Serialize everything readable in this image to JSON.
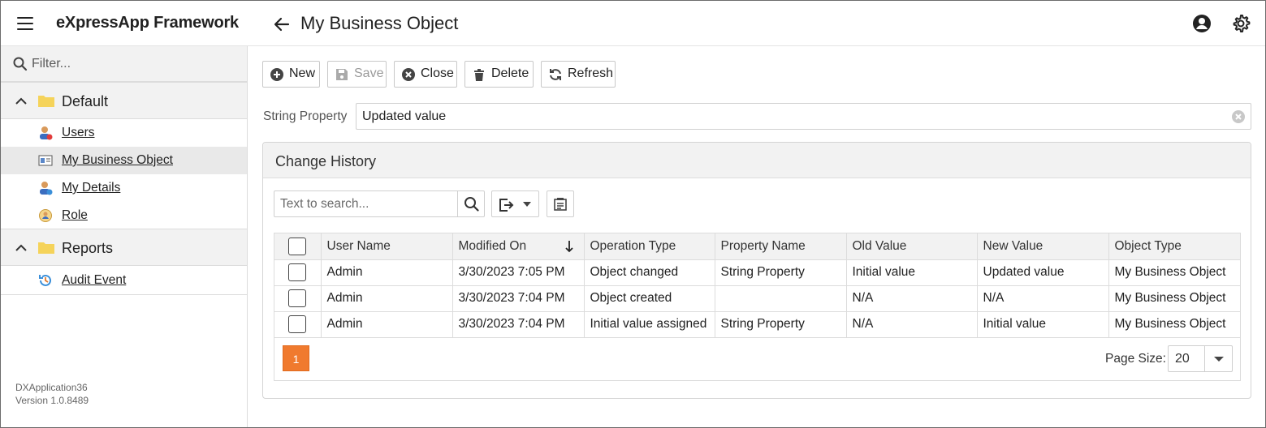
{
  "header": {
    "app_title": "eXpressApp Framework",
    "view_title": "My Business Object"
  },
  "sidebar": {
    "filter_placeholder": "Filter...",
    "groups": [
      {
        "label": "Default",
        "items": [
          {
            "label": "Users",
            "icon": "user-icon"
          },
          {
            "label": "My Business Object",
            "icon": "business-object-icon",
            "active": true
          },
          {
            "label": "My Details",
            "icon": "user-details-icon"
          },
          {
            "label": "Role",
            "icon": "role-icon"
          }
        ]
      },
      {
        "label": "Reports",
        "items": [
          {
            "label": "Audit Event",
            "icon": "audit-icon"
          }
        ]
      }
    ],
    "app_name": "DXApplication36",
    "version": "Version 1.0.8489"
  },
  "toolbar": {
    "new_label": "New",
    "save_label": "Save",
    "close_label": "Close",
    "delete_label": "Delete",
    "refresh_label": "Refresh"
  },
  "editor": {
    "label": "String Property",
    "value": "Updated value"
  },
  "history": {
    "title": "Change History",
    "search_placeholder": "Text to search...",
    "columns": [
      "User Name",
      "Modified On",
      "Operation Type",
      "Property Name",
      "Old Value",
      "New Value",
      "Object Type"
    ],
    "rows": [
      [
        "Admin",
        "3/30/2023 7:05 PM",
        "Object changed",
        "String Property",
        "Initial value",
        "Updated value",
        "My Business Object"
      ],
      [
        "Admin",
        "3/30/2023 7:04 PM",
        "Object created",
        "",
        "N/A",
        "N/A",
        "My Business Object"
      ],
      [
        "Admin",
        "3/30/2023 7:04 PM",
        "Initial value assigned",
        "String Property",
        "N/A",
        "Initial value",
        "My Business Object"
      ]
    ],
    "page": "1",
    "page_size_label": "Page Size:",
    "page_size": "20"
  },
  "colors": {
    "accent": "#f07a2e",
    "header_bg": "#f2f2f2"
  }
}
